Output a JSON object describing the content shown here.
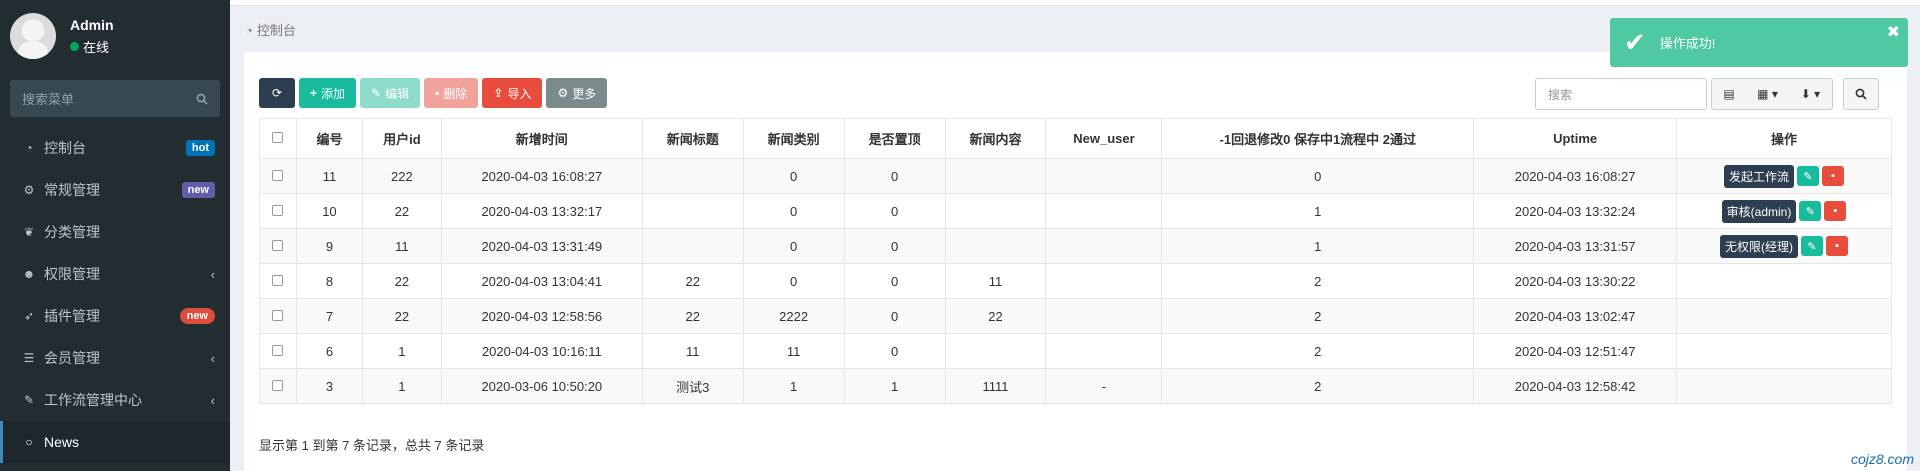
{
  "user": {
    "name": "Admin",
    "status": "在线"
  },
  "sidebar": {
    "search_placeholder": "搜索菜单",
    "items": [
      {
        "label": "控制台",
        "icon": "dashboard-icon",
        "badge": "hot"
      },
      {
        "label": "常规管理",
        "icon": "cogs-icon",
        "badge": "new"
      },
      {
        "label": "分类管理",
        "icon": "leaf-icon",
        "badge": ""
      },
      {
        "label": "权限管理",
        "icon": "group-icon",
        "badge": ""
      },
      {
        "label": "插件管理",
        "icon": "rocket-icon",
        "badge": "new"
      },
      {
        "label": "会员管理",
        "icon": "list-icon",
        "badge": ""
      },
      {
        "label": "工作流管理中心",
        "icon": "magic-icon",
        "badge": ""
      },
      {
        "label": "News",
        "icon": "circle-icon",
        "badge": ""
      }
    ]
  },
  "breadcrumb": "控制台",
  "toolbar": {
    "refresh": "",
    "add": "添加",
    "edit": "编辑",
    "delete": "删除",
    "import": "导入",
    "more": "更多",
    "search_placeholder": "搜索"
  },
  "table": {
    "headers": [
      "编号",
      "用户id",
      "新增时间",
      "新闻标题",
      "新闻类别",
      "是否置顶",
      "新闻内容",
      "New_user",
      "-1回退修改0 保存中1流程中 2通过",
      "Uptime",
      "操作"
    ],
    "rows": [
      [
        "11",
        "222",
        "2020-04-03 16:08:27",
        "",
        "0",
        "0",
        "",
        "",
        "0",
        "2020-04-03 16:08:27"
      ],
      [
        "10",
        "22",
        "2020-04-03 13:32:17",
        "",
        "0",
        "0",
        "",
        "",
        "1",
        "2020-04-03 13:32:24"
      ],
      [
        "9",
        "11",
        "2020-04-03 13:31:49",
        "",
        "0",
        "0",
        "",
        "",
        "1",
        "2020-04-03 13:31:57"
      ],
      [
        "8",
        "22",
        "2020-04-03 13:04:41",
        "22",
        "0",
        "0",
        "11",
        "",
        "2",
        "2020-04-03 13:30:22"
      ],
      [
        "7",
        "22",
        "2020-04-03 12:58:56",
        "22",
        "2222",
        "0",
        "22",
        "",
        "2",
        "2020-04-03 13:02:47"
      ],
      [
        "6",
        "1",
        "2020-04-03 10:16:11",
        "11",
        "11",
        "0",
        "",
        "",
        "2",
        "2020-04-03 12:51:47"
      ],
      [
        "3",
        "1",
        "2020-03-06 10:50:20",
        "测试3",
        "1",
        "1",
        "1111",
        "-",
        "2",
        "2020-04-03 12:58:42"
      ]
    ],
    "ops": [
      "发起工作流",
      "审核(admin)",
      "无权限(经理)",
      "",
      "",
      "",
      ""
    ]
  },
  "pagination_info": "显示第 1 到第 7 条记录，总共 7 条记录",
  "toast": {
    "message": "操作成功!"
  },
  "watermark": "cojz8.com",
  "colors": {
    "sidebar": "#222d32",
    "success": "#18bc9c",
    "danger": "#e74c3c",
    "toast": "#4fc8a4"
  }
}
